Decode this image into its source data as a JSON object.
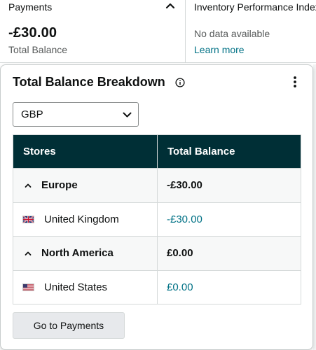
{
  "payments_card": {
    "title": "Payments",
    "amount": "-£30.00",
    "amount_label": "Total Balance"
  },
  "ipi_card": {
    "title": "Inventory Performance Index",
    "no_data": "No data available",
    "link": "Learn more"
  },
  "breakdown": {
    "title": "Total Balance Breakdown",
    "currency": "GBP",
    "headers": {
      "stores": "Stores",
      "total": "Total Balance"
    },
    "rows": [
      {
        "type": "region",
        "name": "Europe",
        "total": "-£30.00"
      },
      {
        "type": "country",
        "name": "United Kingdom",
        "total": "-£30.00",
        "flag": "uk-flag-icon"
      },
      {
        "type": "region",
        "name": "North America",
        "total": "£0.00"
      },
      {
        "type": "country",
        "name": "United States",
        "total": "£0.00",
        "flag": "us-flag-icon"
      }
    ],
    "button": "Go to Payments"
  },
  "colors": {
    "header_bg": "#002f36",
    "link": "#007185",
    "region_row_bg": "#f7f8f8",
    "button_bg": "#e7e9ec"
  },
  "icons": [
    "chevron-up-icon",
    "info-icon",
    "more-vertical-icon",
    "chevron-down-icon",
    "caret-up-icon",
    "uk-flag-icon",
    "us-flag-icon"
  ]
}
